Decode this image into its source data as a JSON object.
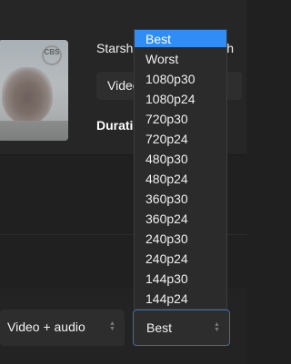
{
  "header": {
    "thumbnail_logo": "CBS",
    "title": "Starship Flight 4 Launch",
    "type_value": "Video + audio",
    "duration_label": "Duration"
  },
  "quality_dropdown": {
    "options": [
      "Best",
      "Worst",
      "1080p30",
      "1080p24",
      "720p30",
      "720p24",
      "480p30",
      "480p24",
      "360p30",
      "360p24",
      "240p30",
      "240p24",
      "144p30",
      "144p24"
    ],
    "selected_index": 0
  },
  "bottom_controls": {
    "media_select": "Video + audio",
    "quality_select": "Best"
  },
  "colors": {
    "selection": "#2f8df5",
    "focus_border": "#3b6fb0"
  },
  "icons": {
    "select_chevron": "up-down-chevron-icon"
  }
}
